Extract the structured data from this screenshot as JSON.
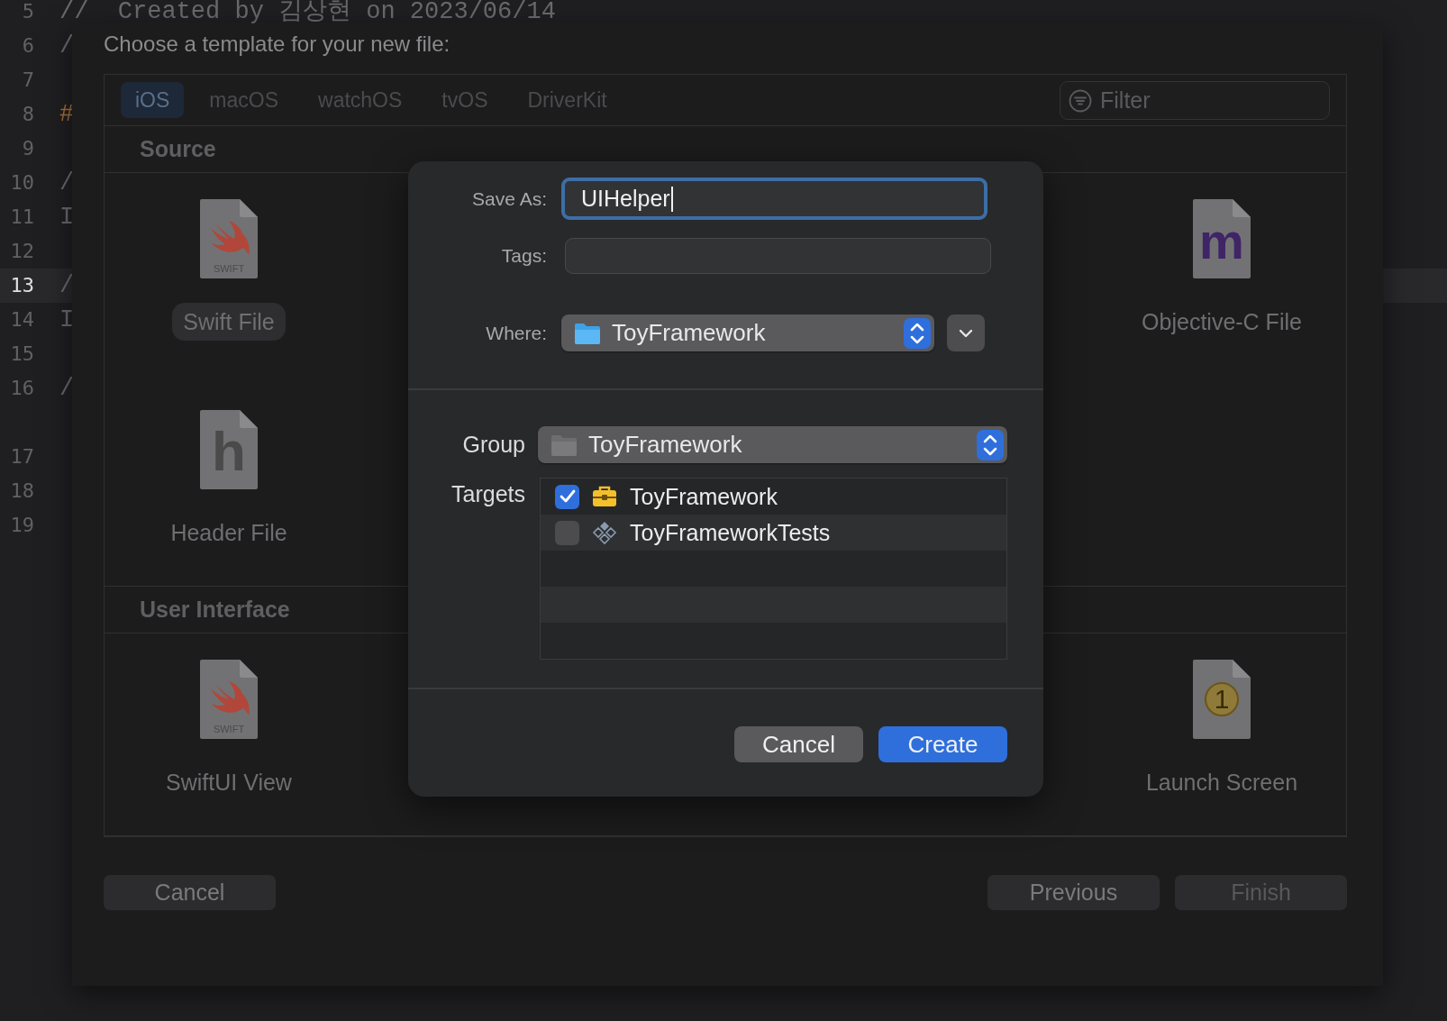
{
  "editor": {
    "lines": [
      {
        "number": "5",
        "code": "//  Created by 김상현 on 2023/06/14",
        "current": false,
        "wrapped": false
      },
      {
        "number": "6",
        "code": "/",
        "current": false,
        "wrapped": false
      },
      {
        "number": "7",
        "current": false,
        "wrapped": false
      },
      {
        "number": "8",
        "code": "#",
        "current": false,
        "wrapped": false
      },
      {
        "number": "9",
        "current": false,
        "wrapped": false
      },
      {
        "number": "10",
        "code": "/",
        "current": false,
        "wrapped": false
      },
      {
        "number": "11",
        "code": "I",
        "current": false,
        "wrapped": false
      },
      {
        "number": "12",
        "current": false,
        "wrapped": false
      },
      {
        "number": "13",
        "code": "/",
        "current": true,
        "wrapped": false
      },
      {
        "number": "14",
        "code": "I",
        "current": false,
        "wrapped": false
      },
      {
        "number": "15",
        "current": false,
        "wrapped": false
      },
      {
        "number": "16",
        "code": "/",
        "current": false,
        "wrapped": true
      },
      {
        "number": "17",
        "current": false,
        "wrapped": false
      },
      {
        "number": "18",
        "current": false,
        "wrapped": false
      },
      {
        "number": "19",
        "current": false,
        "wrapped": false
      }
    ]
  },
  "template_chooser": {
    "title": "Choose a template for your new file:",
    "platform_tabs": [
      {
        "label": "iOS",
        "selected": true
      },
      {
        "label": "macOS",
        "selected": false
      },
      {
        "label": "watchOS",
        "selected": false
      },
      {
        "label": "tvOS",
        "selected": false
      },
      {
        "label": "DriverKit",
        "selected": false
      }
    ],
    "filter": {
      "placeholder": "Filter"
    },
    "sections": [
      {
        "title": "Source",
        "rows": [
          [
            {
              "label": "Swift File",
              "kind": "swift",
              "icon_text": "SWIFT",
              "selected": true
            },
            {
              "label": "Objective-C File",
              "kind": "objc",
              "icon_text": "m",
              "selected": false
            }
          ],
          [
            {
              "label": "Header File",
              "kind": "header",
              "icon_text": "h",
              "selected": false
            }
          ]
        ]
      },
      {
        "title": "User Interface",
        "rows": [
          [
            {
              "label": "SwiftUI View",
              "kind": "swift",
              "icon_text": "SWIFT",
              "selected": false
            },
            {
              "label": "Launch Screen",
              "kind": "launch",
              "icon_text": "1",
              "selected": false
            }
          ]
        ]
      }
    ],
    "buttons": [
      {
        "label": "Cancel",
        "disabled": false
      },
      {
        "label": "Previous",
        "disabled": false
      },
      {
        "label": "Finish",
        "disabled": true
      }
    ]
  },
  "save_dialog": {
    "save_as": {
      "label": "Save As:",
      "value": "UIHelper",
      "focused": true
    },
    "tags": {
      "label": "Tags:"
    },
    "where": {
      "label": "Where:",
      "value": "ToyFramework"
    },
    "group": {
      "label": "Group",
      "value": "ToyFramework"
    },
    "targets": {
      "label": "Targets",
      "items": [
        {
          "name": "ToyFramework",
          "kind": "framework",
          "checked": true
        },
        {
          "name": "ToyFrameworkTests",
          "kind": "tests",
          "checked": false
        }
      ]
    },
    "buttons": [
      {
        "label": "Cancel",
        "kind": "secondary"
      },
      {
        "label": "Create",
        "kind": "primary"
      }
    ]
  }
}
